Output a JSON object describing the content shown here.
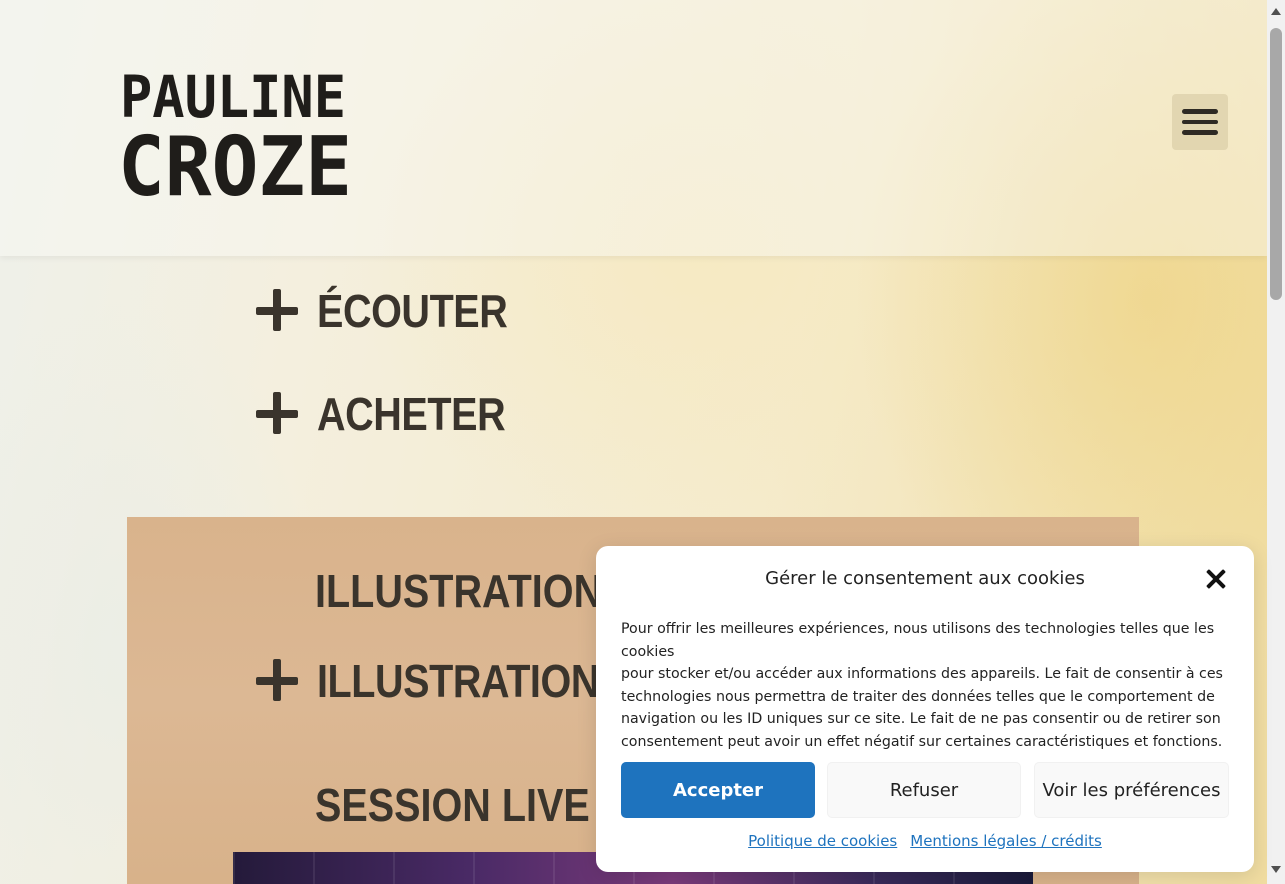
{
  "site": {
    "logo_line1": "PAULINE",
    "logo_line2": "CROZE"
  },
  "header": {
    "menu_icon": "hamburger-menu-icon"
  },
  "nav": {
    "items": [
      {
        "label": "ÉCOUTER",
        "icon": "plus-icon"
      },
      {
        "label": "ACHETER",
        "icon": "plus-icon"
      }
    ]
  },
  "section": {
    "title1": "ILLUSTRATION",
    "title2": "ILLUSTRATION",
    "title3": "SESSION LIVE"
  },
  "cookie_modal": {
    "title": "Gérer le consentement aux cookies",
    "text_lines": [
      "Pour offrir les meilleures expériences, nous utilisons des technologies telles que les cookies",
      "pour stocker et/ou accéder aux informations des appareils. Le fait de consentir à ces",
      "technologies nous permettra de traiter des données telles que le comportement de",
      "navigation ou les ID uniques sur ce site. Le fait de ne pas consentir ou de retirer son",
      "consentement peut avoir un effet négatif sur certaines caractéristiques et fonctions."
    ],
    "accept_label": "Accepter",
    "refuse_label": "Refuser",
    "prefs_label": "Voir les préférences",
    "link_cookies": "Politique de cookies",
    "link_legal": "Mentions légales / crédits"
  },
  "colors": {
    "accent": "#1e73be",
    "text_dark": "#3a342c",
    "section_bg": "#d9b38c"
  }
}
